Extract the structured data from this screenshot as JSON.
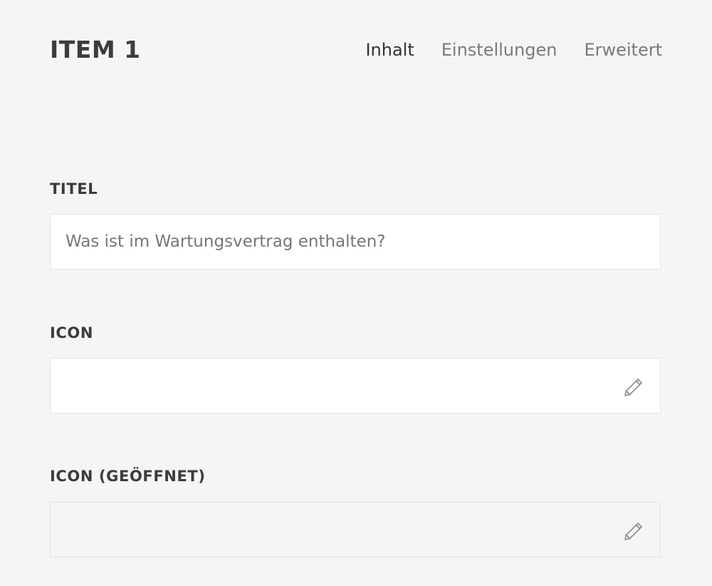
{
  "header": {
    "title": "ITEM 1",
    "tabs": [
      {
        "label": "Inhalt",
        "active": true
      },
      {
        "label": "Einstellungen",
        "active": false
      },
      {
        "label": "Erweitert",
        "active": false
      }
    ]
  },
  "fields": {
    "titel": {
      "label": "TITEL",
      "value": "Was ist im Wartungsvertrag enthalten?"
    },
    "icon": {
      "label": "ICON",
      "value": "",
      "action_icon": "pencil-icon"
    },
    "icon_geoeffnet": {
      "label": "ICON (GEÖFFNET)",
      "value": "",
      "action_icon": "pencil-icon"
    }
  },
  "colors": {
    "background": "#f5f5f5",
    "input_background": "#ffffff",
    "input_border": "#e3e3e3",
    "text_dark": "#3b3b3b",
    "text_muted": "#7a7a7a"
  }
}
